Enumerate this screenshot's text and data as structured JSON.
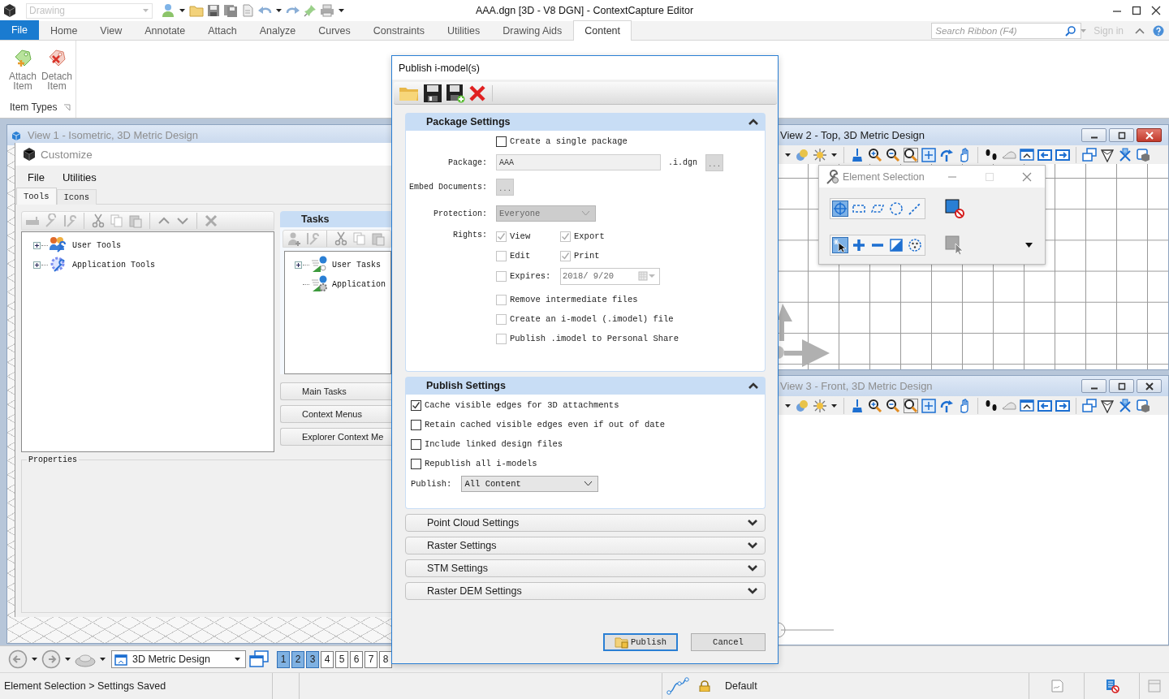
{
  "title_bar": {
    "title": "AAA.dgn [3D - V8 DGN] - ContextCapture Editor",
    "workspace_combo": {
      "value": "Drawing",
      "disabled": true
    }
  },
  "ribbon": {
    "file_button": "File",
    "tabs": [
      {
        "label": "Home",
        "selected": false
      },
      {
        "label": "View",
        "selected": false
      },
      {
        "label": "Annotate",
        "selected": false
      },
      {
        "label": "Attach",
        "selected": false
      },
      {
        "label": "Analyze",
        "selected": false
      },
      {
        "label": "Curves",
        "selected": false
      },
      {
        "label": "Constraints",
        "selected": false
      },
      {
        "label": "Utilities",
        "selected": false
      },
      {
        "label": "Drawing Aids",
        "selected": false
      },
      {
        "label": "Content",
        "selected": true
      }
    ],
    "search": {
      "placeholder": "Search Ribbon (F4)"
    },
    "sign_in": {
      "label": "Sign in",
      "disabled": true
    },
    "groups": [
      {
        "label": "Item Types",
        "buttons": [
          {
            "label": "Attach Item"
          },
          {
            "label": "Detach Item"
          }
        ]
      }
    ]
  },
  "views": [
    {
      "title": "View 1 - Isometric, 3D Metric Design",
      "active": false
    },
    {
      "title": "View 2 - Top, 3D Metric Design",
      "active": true
    },
    {
      "title": "View 3 - Front, 3D Metric Design",
      "active": false
    }
  ],
  "customize": {
    "title": "Customize",
    "menu": [
      "File",
      "Utilities"
    ],
    "tabs": [
      {
        "label": "Tools",
        "selected": true
      },
      {
        "label": "Icons",
        "selected": false
      }
    ],
    "tools_tree": [
      {
        "label": "User Tools",
        "expanded": false
      },
      {
        "label": "Application Tools",
        "expanded": false
      }
    ],
    "tasks": {
      "title": "Tasks",
      "tree": [
        {
          "label": "User Tasks",
          "kind": "group",
          "expanded": false
        },
        {
          "label": "Application",
          "kind": "leaf"
        }
      ]
    },
    "task_buttons": [
      "Main Tasks",
      "Context Menus",
      "Explorer Context Me"
    ],
    "properties": {
      "title": "Properties"
    }
  },
  "element_selection": {
    "title": "Element Selection",
    "methods": [
      {
        "selected": true
      },
      {
        "selected": false
      },
      {
        "selected": false
      },
      {
        "selected": false
      },
      {
        "selected": false
      }
    ],
    "modes": [
      {
        "selected": true
      },
      {
        "selected": false
      },
      {
        "selected": false
      },
      {
        "selected": false
      },
      {
        "selected": false
      }
    ]
  },
  "publish_dialog": {
    "title": "Publish i-model(s)",
    "package": {
      "title": "Package Settings",
      "expanded": true,
      "single_package": {
        "label": "Create a single package",
        "checked": false,
        "disabled": false
      },
      "package_name": {
        "label": "Package:",
        "value": "AAA",
        "suffix": ".i.dgn",
        "browse": "..."
      },
      "embed_documents": {
        "label": "Embed Documents:",
        "browse": "..."
      },
      "protection": {
        "label": "Protection:",
        "value": "Everyone"
      },
      "rights": {
        "label": "Rights:",
        "options": [
          {
            "label": "View",
            "checked": true,
            "disabled": true
          },
          {
            "label": "Export",
            "checked": true,
            "disabled": true
          },
          {
            "label": "Edit",
            "checked": false,
            "disabled": true
          },
          {
            "label": "Print",
            "checked": true,
            "disabled": true
          }
        ]
      },
      "expires": {
        "label": "Expires:",
        "checked": false,
        "disabled": true,
        "date": "2018/ 9/20"
      },
      "options": [
        {
          "label": "Remove intermediate files",
          "checked": false,
          "disabled": true
        },
        {
          "label": "Create an i-model (.imodel) file",
          "checked": false,
          "disabled": true
        },
        {
          "label": "Publish .imodel to Personal Share",
          "checked": false,
          "disabled": true
        }
      ]
    },
    "publish": {
      "title": "Publish Settings",
      "expanded": true,
      "options": [
        {
          "label": "Cache visible edges for 3D attachments",
          "checked": true,
          "disabled": false
        },
        {
          "label": "Retain cached visible edges even if out of date",
          "checked": false,
          "disabled": false
        },
        {
          "label": "Include linked design files",
          "checked": false,
          "disabled": false
        },
        {
          "label": "Republish all i-models",
          "checked": false,
          "disabled": false
        }
      ],
      "publish_combo": {
        "label": "Publish:",
        "value": "All Content"
      }
    },
    "collapsed_sections": [
      {
        "title": "Point Cloud Settings",
        "expanded": false
      },
      {
        "title": "Raster Settings",
        "expanded": false
      },
      {
        "title": "STM Settings",
        "expanded": false
      },
      {
        "title": "Raster DEM Settings",
        "expanded": false
      }
    ],
    "buttons": [
      {
        "label": "Publish",
        "default": true
      },
      {
        "label": "Cancel",
        "default": false
      }
    ]
  },
  "bottom_toolbar": {
    "view_combo": "3D Metric Design",
    "view_buttons": [
      {
        "label": "1",
        "on": true
      },
      {
        "label": "2",
        "on": true
      },
      {
        "label": "3",
        "on": true
      },
      {
        "label": "4",
        "on": false
      },
      {
        "label": "5",
        "on": false
      },
      {
        "label": "6",
        "on": false
      },
      {
        "label": "7",
        "on": false
      },
      {
        "label": "8",
        "on": false
      }
    ]
  },
  "status_bar": {
    "message": "Element Selection > Settings Saved",
    "level": "Default"
  }
}
